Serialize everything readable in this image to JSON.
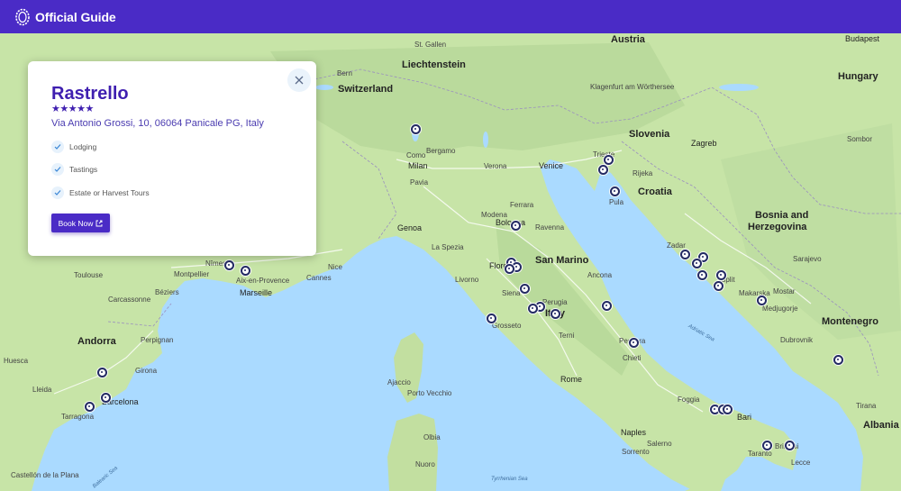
{
  "header": {
    "brand": "Official Guide",
    "logo_icon": "wreath-logo-icon"
  },
  "card": {
    "title": "Rastrello",
    "stars": "★★★★★",
    "rating": 5,
    "address": "Via Antonio Grossi, 10, 06064 Panicale PG, Italy",
    "features": [
      "Lodging",
      "Tastings",
      "Estate or Harvest Tours"
    ],
    "book_label": "Book Now",
    "close_icon": "close-icon",
    "external_icon": "external-link-icon"
  },
  "map": {
    "countries": [
      "Austria",
      "Liechtenstein",
      "Switzerland",
      "Hungary",
      "Slovenia",
      "Croatia",
      "Bosnia and",
      "Herzegovina",
      "San Marino",
      "Italy",
      "Andorra",
      "Montenegro",
      "Albania"
    ],
    "cities": [
      "St. Gallen",
      "Budapest",
      "Bern",
      "Klagenfurt am Wörthersee",
      "Bergamo",
      "Como",
      "Milan",
      "Verona",
      "Venice",
      "Trieste",
      "Zagreb",
      "Pavia",
      "Rijeka",
      "Pula",
      "Sombor",
      "Bologna",
      "Modena",
      "Ferrara",
      "Ravenna",
      "Genoa",
      "La Spezia",
      "Florence",
      "Livorno",
      "Siena",
      "Ancona",
      "Zadar",
      "Toulouse",
      "Montpellier",
      "Nîmes",
      "Aix-en-Provence",
      "Marseille",
      "Nice",
      "Cannes",
      "Béziers",
      "Carcassonne",
      "Perpignan",
      "Girona",
      "Barcelona",
      "Tarragona",
      "Grosseto",
      "Perugia",
      "Terni",
      "Pescara",
      "Chieti",
      "Rome",
      "Split",
      "Makarska",
      "Mostar",
      "Medjugorje",
      "Dubrovnik",
      "Naples",
      "Foggia",
      "Bari",
      "Taranto",
      "Brindisi",
      "Lecce",
      "Sarajevo",
      "Tirana",
      "Huesca",
      "Lleida",
      "Ajaccio",
      "Porto Vecchio",
      "Nuoro",
      "Olbia",
      "Castellón de la Plana",
      "Sorrento",
      "Salerno"
    ],
    "seas": [
      "Adriatic Sea",
      "Tyrrhenian Sea",
      "Balearic Sea"
    ],
    "markers_count": 36
  }
}
